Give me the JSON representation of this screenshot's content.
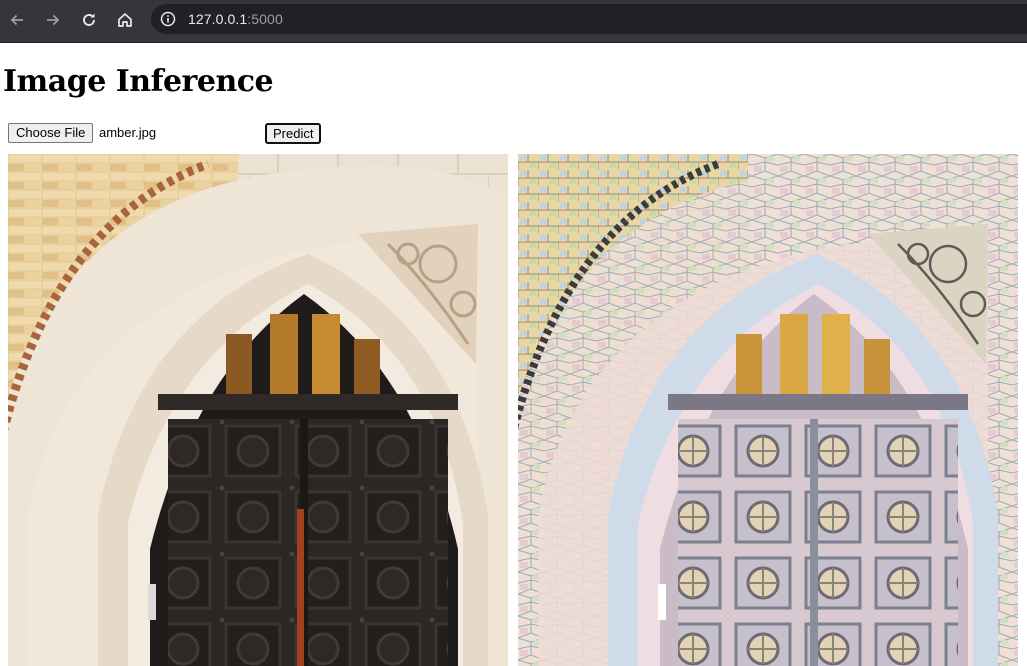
{
  "browser": {
    "url_host": "127.0.0.1",
    "url_port": ":5000",
    "icons": [
      "back-icon",
      "forward-icon",
      "reload-icon",
      "home-icon",
      "info-icon"
    ]
  },
  "page": {
    "title": "Image Inference",
    "choose_file_label": "Choose File",
    "file_name": "amber.jpg",
    "predict_label": "Predict"
  },
  "colors": {
    "chrome_bg": "#35363a",
    "omnibox_bg": "#202124",
    "stone": "#ece0cf",
    "brick": "#e3c18f",
    "door": "#2a2624",
    "glass": "#b07a2c",
    "mosaic_pink": "#e9c9d6",
    "mosaic_blue": "#b9d4e6"
  }
}
